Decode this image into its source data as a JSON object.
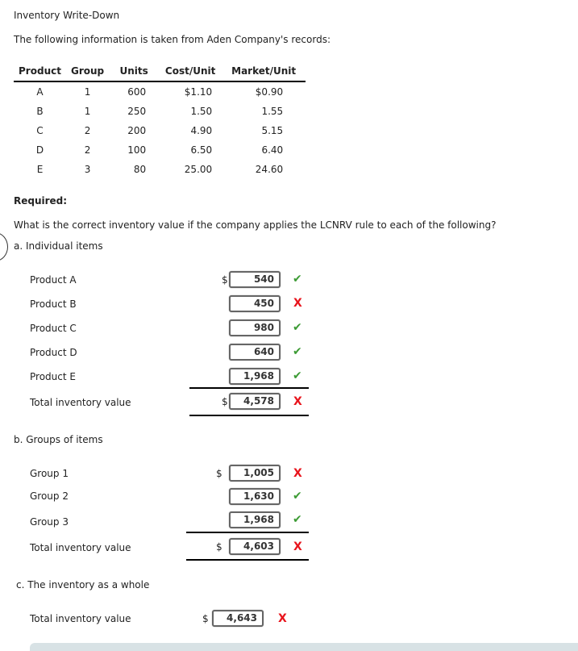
{
  "header": {
    "title": "Inventory Write-Down",
    "intro": "The following information is taken from Aden Company's records:"
  },
  "records_table": {
    "columns": [
      "Product",
      "Group",
      "Units",
      "Cost/Unit",
      "Market/Unit"
    ],
    "rows": [
      {
        "product": "A",
        "group": "1",
        "units": "600",
        "cost": "$1.10",
        "market": "$0.90"
      },
      {
        "product": "B",
        "group": "1",
        "units": "250",
        "cost": "1.50",
        "market": "1.55"
      },
      {
        "product": "C",
        "group": "2",
        "units": "200",
        "cost": "4.90",
        "market": "5.15"
      },
      {
        "product": "D",
        "group": "2",
        "units": "100",
        "cost": "6.50",
        "market": "6.40"
      },
      {
        "product": "E",
        "group": "3",
        "units": "80",
        "cost": "25.00",
        "market": "24.60"
      }
    ]
  },
  "required": {
    "heading": "Required:",
    "question": "What is the correct inventory value if the company applies the LCNRV rule to each of the following?"
  },
  "part_a": {
    "label": "a. Individual items",
    "currency": "$",
    "rows": [
      {
        "label": "Product A",
        "value": "540",
        "status": "correct"
      },
      {
        "label": "Product B",
        "value": "450",
        "status": "incorrect"
      },
      {
        "label": "Product C",
        "value": "980",
        "status": "correct"
      },
      {
        "label": "Product D",
        "value": "640",
        "status": "correct"
      },
      {
        "label": "Product E",
        "value": "1,968",
        "status": "correct"
      }
    ],
    "total": {
      "label": "Total inventory value",
      "value": "4,578",
      "status": "incorrect"
    }
  },
  "part_b": {
    "label": "b. Groups of items",
    "currency": "$",
    "rows": [
      {
        "label": "Group 1",
        "value": "1,005",
        "status": "incorrect"
      },
      {
        "label": "Group 2",
        "value": "1,630",
        "status": "correct"
      },
      {
        "label": "Group 3",
        "value": "1,968",
        "status": "correct"
      }
    ],
    "total": {
      "label": "Total inventory value",
      "value": "4,603",
      "status": "incorrect"
    }
  },
  "part_c": {
    "label": "c. The inventory as a whole",
    "currency": "$",
    "total": {
      "label": "Total inventory value",
      "value": "4,643",
      "status": "incorrect"
    }
  },
  "marks": {
    "correct_glyph": "✔",
    "incorrect_glyph": "X",
    "correct_color": "#3c9b34",
    "incorrect_color": "#e8141c"
  }
}
